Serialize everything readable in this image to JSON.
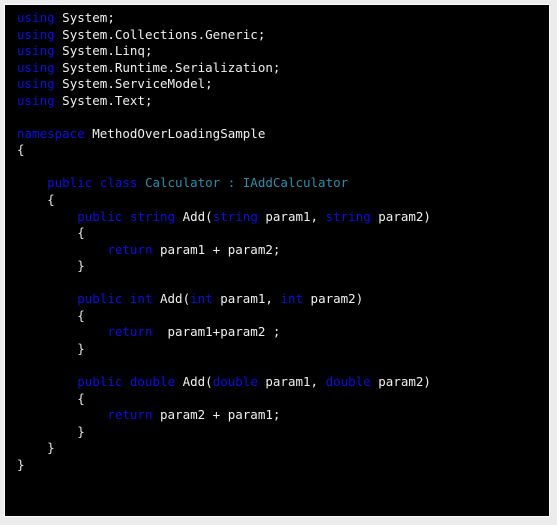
{
  "window": {
    "panel_background": "#000000",
    "page_background": "#ececec",
    "border_color": "#fdfdfd"
  },
  "theme": {
    "keyword_color": "#0c0ce8",
    "type_color": "#2a8fad",
    "default_text_color": "#ededed",
    "brace_color": "#e6e6e6"
  },
  "code": {
    "language": "csharp",
    "namespace_name": "MethodOverLoadingSample",
    "class_name": "Calculator",
    "interface_name": "IAddCalculator",
    "method_name": "Add",
    "lines": [
      {
        "id": "line-1",
        "indent": 0,
        "tokens": [
          {
            "t": "using",
            "c": "kw"
          },
          {
            "t": " System;",
            "c": "def"
          }
        ]
      },
      {
        "id": "line-2",
        "indent": 0,
        "tokens": [
          {
            "t": "using",
            "c": "kw"
          },
          {
            "t": " System.Collections.Generic;",
            "c": "def"
          }
        ]
      },
      {
        "id": "line-3",
        "indent": 0,
        "tokens": [
          {
            "t": "using",
            "c": "kw"
          },
          {
            "t": " System.Linq;",
            "c": "def"
          }
        ]
      },
      {
        "id": "line-4",
        "indent": 0,
        "tokens": [
          {
            "t": "using",
            "c": "kw"
          },
          {
            "t": " System.Runtime.Serialization;",
            "c": "def"
          }
        ]
      },
      {
        "id": "line-5",
        "indent": 0,
        "tokens": [
          {
            "t": "using",
            "c": "kw"
          },
          {
            "t": " System.ServiceModel;",
            "c": "def"
          }
        ]
      },
      {
        "id": "line-6",
        "indent": 0,
        "tokens": [
          {
            "t": "using",
            "c": "kw"
          },
          {
            "t": " System.Text;",
            "c": "def"
          }
        ]
      },
      {
        "id": "line-7",
        "indent": 0,
        "tokens": [
          {
            "t": "",
            "c": "blank"
          }
        ]
      },
      {
        "id": "line-8",
        "indent": 0,
        "tokens": [
          {
            "t": "namespace",
            "c": "kw"
          },
          {
            "t": " MethodOverLoadingSample",
            "c": "def"
          }
        ]
      },
      {
        "id": "line-9",
        "indent": 0,
        "tokens": [
          {
            "t": "{",
            "c": "br"
          }
        ]
      },
      {
        "id": "line-10",
        "indent": 0,
        "tokens": [
          {
            "t": "",
            "c": "blank"
          }
        ]
      },
      {
        "id": "line-11",
        "indent": 4,
        "tokens": [
          {
            "t": "public class",
            "c": "kw"
          },
          {
            "t": " ",
            "c": "def"
          },
          {
            "t": "Calculator : IAddCalculator",
            "c": "type"
          }
        ]
      },
      {
        "id": "line-12",
        "indent": 4,
        "tokens": [
          {
            "t": "{",
            "c": "br"
          }
        ]
      },
      {
        "id": "line-13",
        "indent": 8,
        "tokens": [
          {
            "t": "public string",
            "c": "kw"
          },
          {
            "t": " Add(",
            "c": "def"
          },
          {
            "t": "string",
            "c": "kw"
          },
          {
            "t": " param1, ",
            "c": "def"
          },
          {
            "t": "string",
            "c": "kw"
          },
          {
            "t": " param2)",
            "c": "def"
          }
        ]
      },
      {
        "id": "line-14",
        "indent": 8,
        "tokens": [
          {
            "t": "{",
            "c": "br"
          }
        ]
      },
      {
        "id": "line-15",
        "indent": 12,
        "tokens": [
          {
            "t": "return",
            "c": "kw"
          },
          {
            "t": " param1 + param2;",
            "c": "def"
          }
        ]
      },
      {
        "id": "line-16",
        "indent": 8,
        "tokens": [
          {
            "t": "}",
            "c": "br"
          }
        ]
      },
      {
        "id": "line-17",
        "indent": 0,
        "tokens": [
          {
            "t": "",
            "c": "blank"
          }
        ]
      },
      {
        "id": "line-18",
        "indent": 8,
        "tokens": [
          {
            "t": "public int",
            "c": "kw"
          },
          {
            "t": " Add(",
            "c": "def"
          },
          {
            "t": "int",
            "c": "kw"
          },
          {
            "t": " param1, ",
            "c": "def"
          },
          {
            "t": "int",
            "c": "kw"
          },
          {
            "t": " param2)",
            "c": "def"
          }
        ]
      },
      {
        "id": "line-19",
        "indent": 8,
        "tokens": [
          {
            "t": "{",
            "c": "br"
          }
        ]
      },
      {
        "id": "line-20",
        "indent": 12,
        "tokens": [
          {
            "t": "return",
            "c": "kw"
          },
          {
            "t": "  param1+param2 ;",
            "c": "def"
          }
        ]
      },
      {
        "id": "line-21",
        "indent": 8,
        "tokens": [
          {
            "t": "}",
            "c": "br"
          }
        ]
      },
      {
        "id": "line-22",
        "indent": 0,
        "tokens": [
          {
            "t": "",
            "c": "blank"
          }
        ]
      },
      {
        "id": "line-23",
        "indent": 8,
        "tokens": [
          {
            "t": "public double",
            "c": "kw"
          },
          {
            "t": " Add(",
            "c": "def"
          },
          {
            "t": "double",
            "c": "kw"
          },
          {
            "t": " param1, ",
            "c": "def"
          },
          {
            "t": "double",
            "c": "kw"
          },
          {
            "t": " param2)",
            "c": "def"
          }
        ]
      },
      {
        "id": "line-24",
        "indent": 8,
        "tokens": [
          {
            "t": "{",
            "c": "br"
          }
        ]
      },
      {
        "id": "line-25",
        "indent": 12,
        "tokens": [
          {
            "t": "return",
            "c": "kw"
          },
          {
            "t": " param2 + param1;",
            "c": "def"
          }
        ]
      },
      {
        "id": "line-26",
        "indent": 8,
        "tokens": [
          {
            "t": "}",
            "c": "br"
          }
        ]
      },
      {
        "id": "line-27",
        "indent": 4,
        "tokens": [
          {
            "t": "}",
            "c": "br"
          }
        ]
      },
      {
        "id": "line-28",
        "indent": 0,
        "tokens": [
          {
            "t": "}",
            "c": "br"
          }
        ]
      }
    ]
  }
}
